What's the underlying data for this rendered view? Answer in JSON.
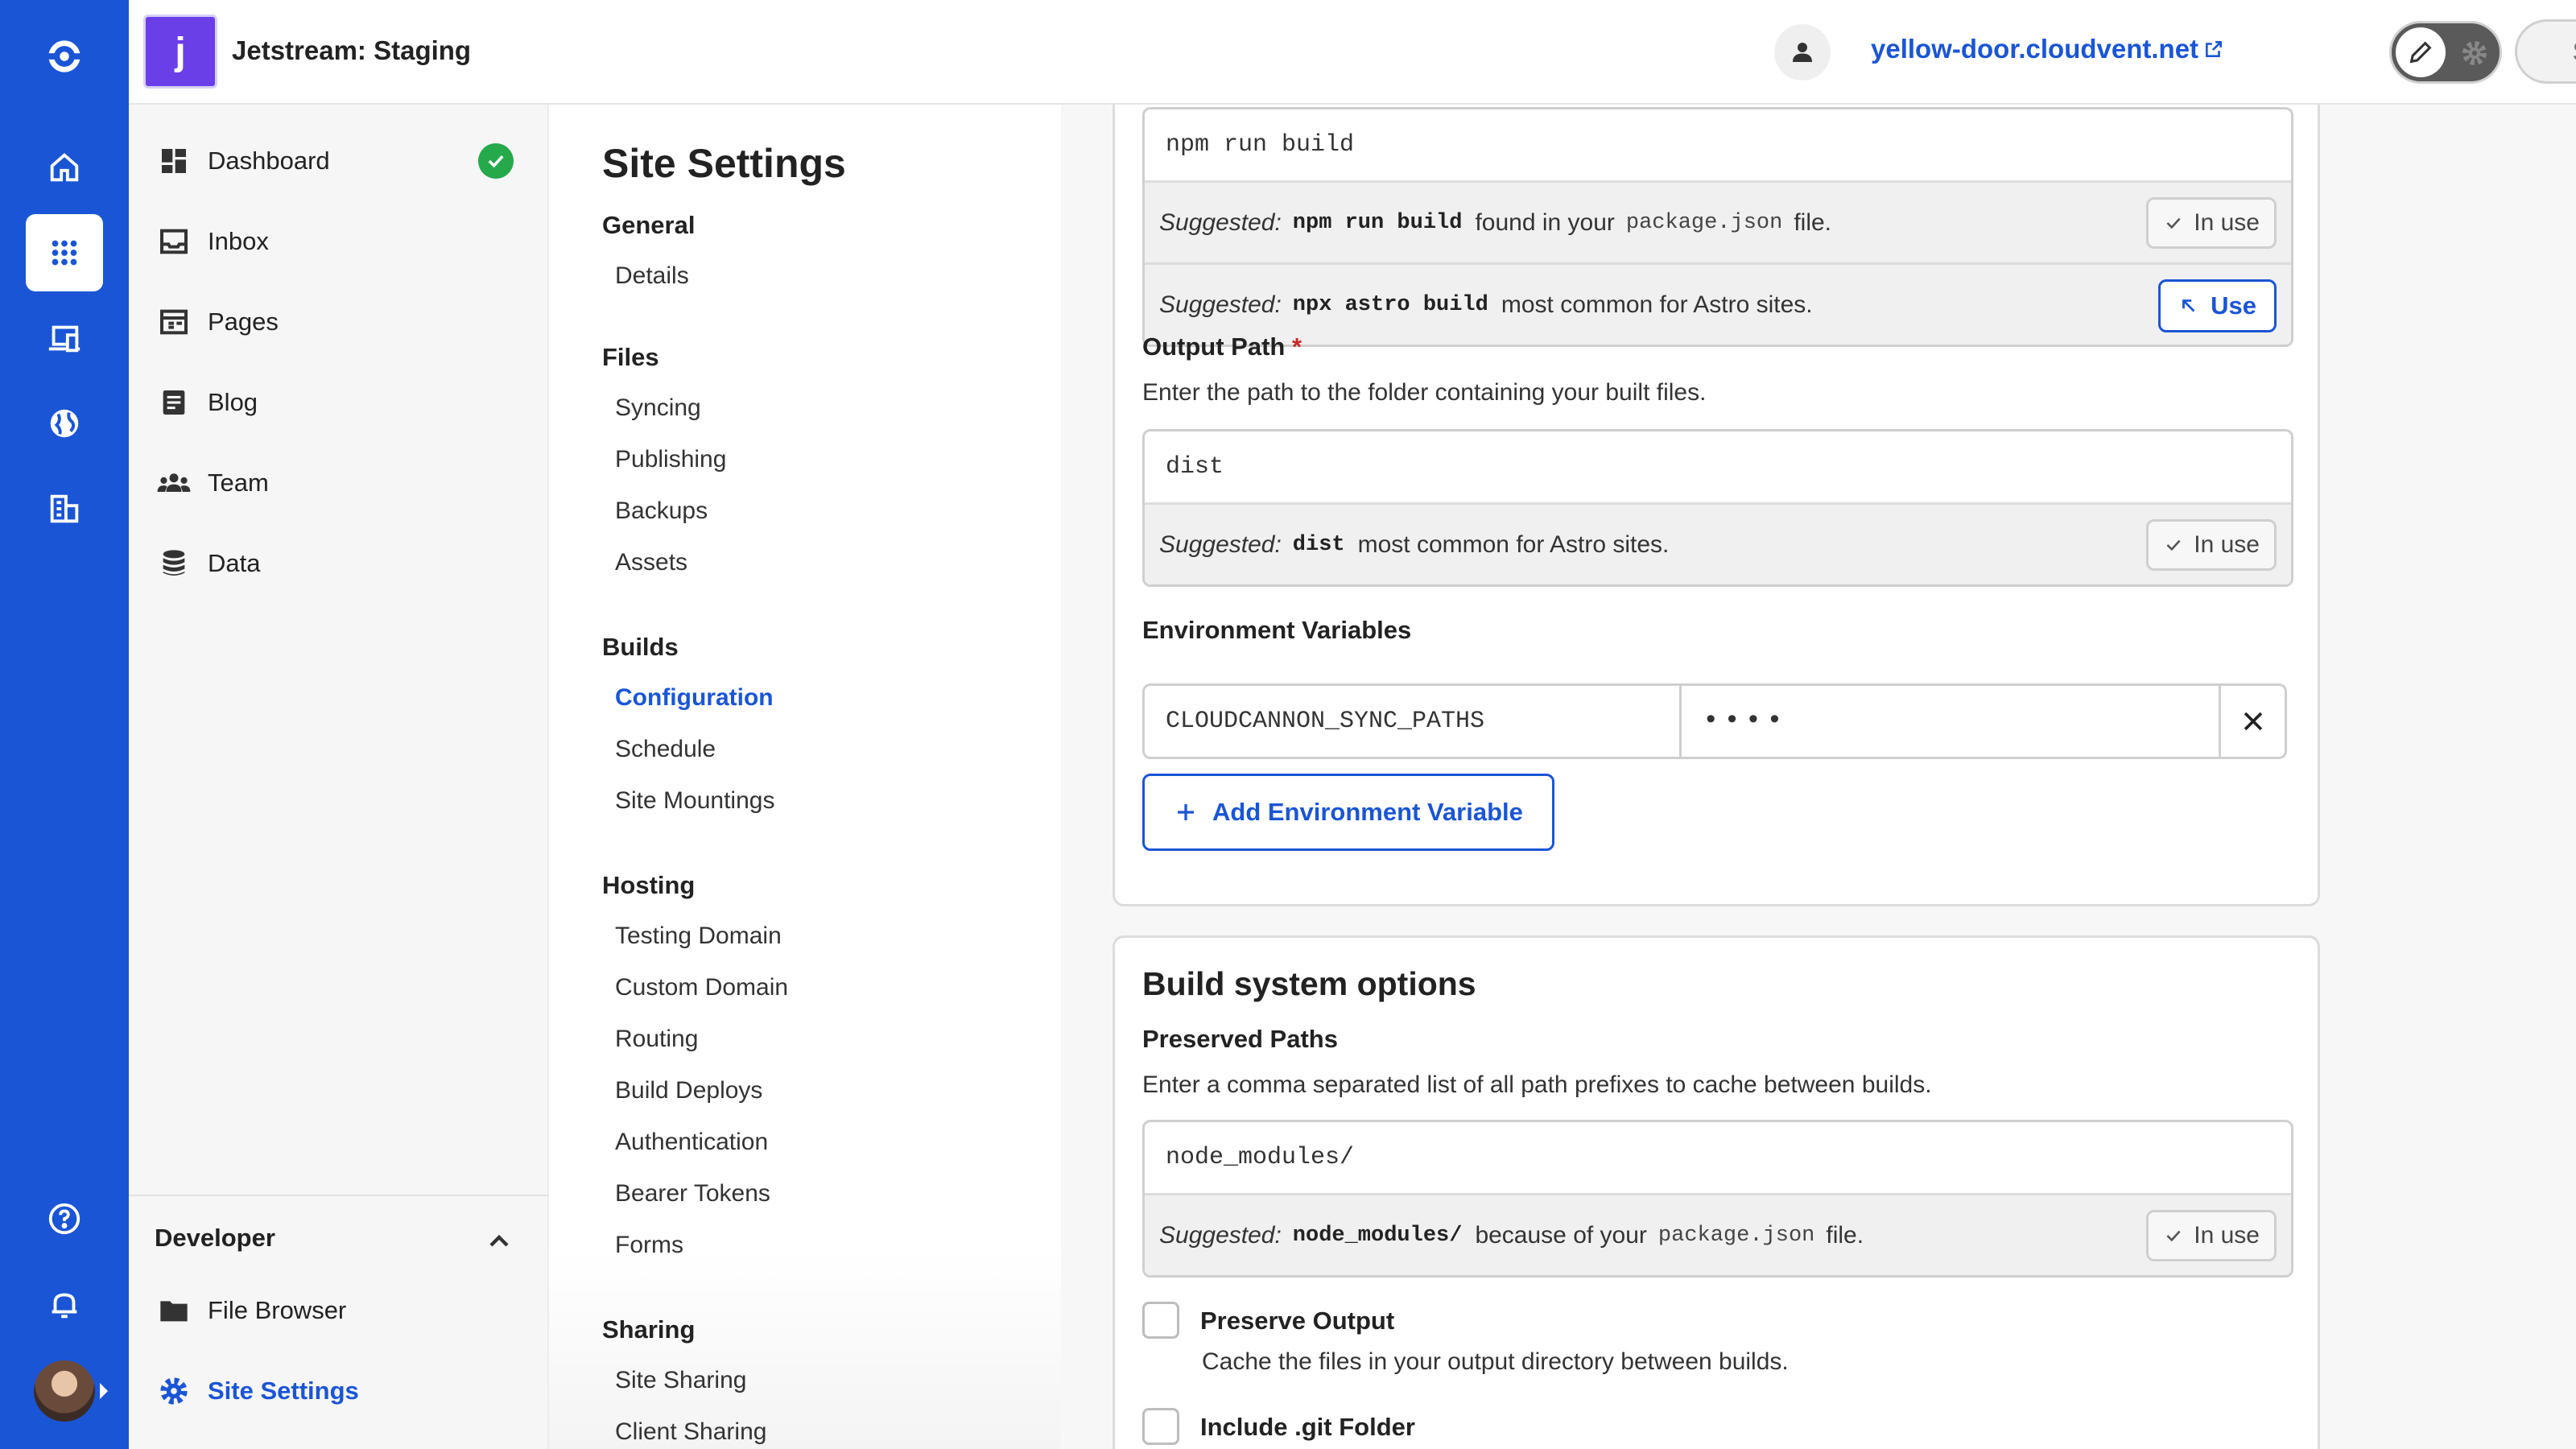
{
  "header": {
    "site_initial": "j",
    "site_name": "Jetstream: Staging",
    "site_url": "yellow-door.cloudvent.net",
    "save_label": "Save"
  },
  "rail": {
    "items": [
      {
        "icon": "logo-icon"
      },
      {
        "icon": "home-icon"
      },
      {
        "icon": "apps-grid-icon",
        "active": true
      },
      {
        "icon": "devices-icon"
      },
      {
        "icon": "globe-icon"
      },
      {
        "icon": "organization-icon"
      },
      {
        "icon": "help-icon"
      },
      {
        "icon": "bell-icon"
      }
    ]
  },
  "leftnav": {
    "items": [
      {
        "label": "Dashboard",
        "icon": "dashboard-icon"
      },
      {
        "label": "Inbox",
        "icon": "inbox-icon"
      },
      {
        "label": "Pages",
        "icon": "pages-icon"
      },
      {
        "label": "Blog",
        "icon": "blog-icon"
      },
      {
        "label": "Team",
        "icon": "team-icon"
      },
      {
        "label": "Data",
        "icon": "database-icon"
      }
    ],
    "developer": {
      "title": "Developer",
      "items": [
        {
          "label": "File Browser",
          "icon": "folder-icon"
        },
        {
          "label": "Site Settings",
          "icon": "gear-icon",
          "active": true
        }
      ]
    }
  },
  "settings_nav": {
    "title": "Site Settings",
    "groups": [
      {
        "title": "General",
        "links": [
          "Details"
        ]
      },
      {
        "title": "Files",
        "links": [
          "Syncing",
          "Publishing",
          "Backups",
          "Assets"
        ]
      },
      {
        "title": "Builds",
        "links": [
          "Configuration",
          "Schedule",
          "Site Mountings"
        ]
      },
      {
        "title": "Hosting",
        "links": [
          "Testing Domain",
          "Custom Domain",
          "Routing",
          "Build Deploys",
          "Authentication",
          "Bearer Tokens",
          "Forms"
        ]
      },
      {
        "title": "Sharing",
        "links": [
          "Site Sharing",
          "Client Sharing"
        ]
      }
    ],
    "active_link": "Configuration"
  },
  "build_command": {
    "value": "npm run build",
    "suggestions": [
      {
        "label": "Suggested:",
        "code": "npm run build",
        "text_before": "found in your",
        "file": "package.json",
        "text_after": "file.",
        "action": "In use"
      },
      {
        "label": "Suggested:",
        "code": "npx astro build",
        "text_before": "most common for Astro sites.",
        "action": "Use"
      }
    ]
  },
  "output_path": {
    "label": "Output Path",
    "required_mark": "*",
    "help": "Enter the path to the folder containing your built files.",
    "value": "dist",
    "suggestion": {
      "label": "Suggested:",
      "code": "dist",
      "text": "most common for Astro sites.",
      "action": "In use"
    }
  },
  "env_vars": {
    "label": "Environment Variables",
    "key": "CLOUDCANNON_SYNC_PATHS",
    "value_masked": "••••",
    "add_label": "Add Environment Variable"
  },
  "build_system": {
    "title": "Build system options",
    "preserved_paths": {
      "label": "Preserved Paths",
      "help": "Enter a comma separated list of all path prefixes to cache between builds.",
      "value": "node_modules/",
      "suggestion": {
        "label": "Suggested:",
        "code": "node_modules/",
        "text_before": "because of your",
        "file": "package.json",
        "text_after": "file.",
        "action": "In use"
      }
    },
    "preserve_output": {
      "label": "Preserve Output",
      "help": "Cache the files in your output directory between builds.",
      "checked": false
    },
    "include_git": {
      "label": "Include .git Folder",
      "checked": false
    }
  },
  "colors": {
    "brand": "#1a55d6",
    "success": "#26a94b",
    "site_avatar": "#6a3fe8"
  }
}
